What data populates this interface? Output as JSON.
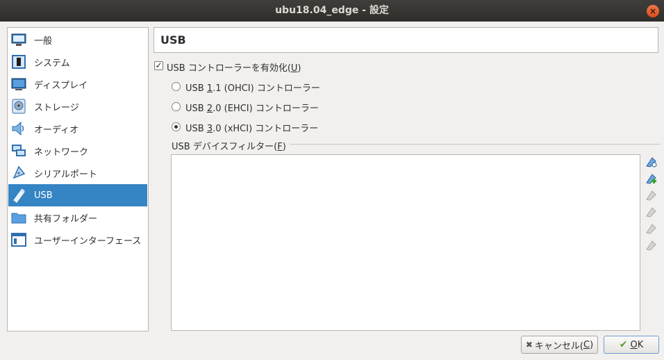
{
  "window": {
    "title": "ubu18.04_edge - 設定",
    "close_glyph": "×"
  },
  "sidebar": {
    "items": [
      {
        "label": "一般",
        "icon": "general-monitor-icon"
      },
      {
        "label": "システム",
        "icon": "system-chip-icon"
      },
      {
        "label": "ディスプレイ",
        "icon": "display-monitor-icon"
      },
      {
        "label": "ストレージ",
        "icon": "storage-disk-icon"
      },
      {
        "label": "オーディオ",
        "icon": "audio-speaker-icon"
      },
      {
        "label": "ネットワーク",
        "icon": "network-icon"
      },
      {
        "label": "シリアルポート",
        "icon": "serial-port-icon"
      },
      {
        "label": "USB",
        "icon": "usb-icon",
        "selected": true
      },
      {
        "label": "共有フォルダー",
        "icon": "shared-folder-icon"
      },
      {
        "label": "ユーザーインターフェース",
        "icon": "user-interface-icon"
      }
    ]
  },
  "main": {
    "header": "USB",
    "enable_usb": {
      "prefix": "USB コントローラーを有効化(",
      "key": "U",
      "suffix": ")",
      "checked": true,
      "check_glyph": "✓"
    },
    "controllers": [
      {
        "prefix": "USB ",
        "key": "1",
        "suffix": ".1 (OHCI) コントローラー",
        "checked": false
      },
      {
        "prefix": "USB ",
        "key": "2",
        "suffix": ".0 (EHCI) コントローラー",
        "checked": false
      },
      {
        "prefix": "USB ",
        "key": "3",
        "suffix": ".0 (xHCI) コントローラー",
        "checked": true
      }
    ],
    "filter_group": {
      "prefix": "USB デバイスフィルター(",
      "key": "F",
      "suffix": ")"
    },
    "filter_tools": [
      "add-filter-icon",
      "add-from-device-icon",
      "edit-filter-icon",
      "remove-filter-icon",
      "move-up-icon",
      "move-down-icon"
    ]
  },
  "buttons": {
    "cancel": {
      "prefix": "キャンセル(",
      "key": "C",
      "suffix": ")",
      "icon": "cancel-x-icon",
      "glyph": "✖"
    },
    "ok": {
      "prefix": "",
      "key": "O",
      "suffix": "K",
      "icon": "ok-check-icon",
      "glyph": "✔"
    }
  },
  "colors": {
    "selection": "#3584c4",
    "titlebar": "#3c3b37",
    "close": "#e95420"
  }
}
